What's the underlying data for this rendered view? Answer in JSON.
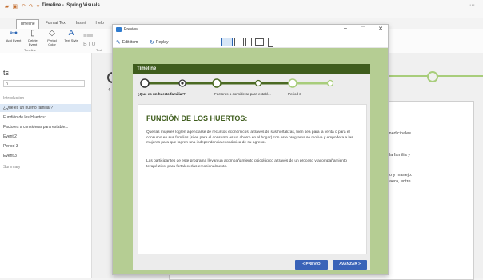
{
  "app": {
    "title": "Timeline - iSpring Visuals",
    "more": "···"
  },
  "ribbon": {
    "tabs": [
      "Timeline",
      "Format Text",
      "Insert",
      "Help"
    ],
    "buttons": {
      "add_event": "Add Event",
      "delete_event": "Delete Event",
      "period_color": "Period Color",
      "text_style": "Text Style"
    },
    "group_timeline": "Timeline",
    "group_text": "Text",
    "format_glyphs": "B  I  U"
  },
  "sidebar": {
    "title": "ts",
    "search_value": "n",
    "items": [
      "Introduction",
      "¿Qué es un huerto familiar?",
      "Fundión de los Huertos:",
      "Factores a considerar para estable...",
      "Event 2",
      "Period 3",
      "Event 3",
      "Summary"
    ],
    "selected_index": 1
  },
  "canvas": {
    "node_label": "4",
    "bg_text": [
      "medicinales.",
      "la familia y",
      "o y manejo.",
      "aera, entre"
    ]
  },
  "preview": {
    "window_title": "Preview",
    "controls": {
      "minimize": "–",
      "maximize": "☐",
      "close": "✕"
    },
    "toolbar": {
      "edit_item": "Edit item",
      "replay": "Replay"
    },
    "slide": {
      "header": "Timeline",
      "timeline_labels": [
        "¿Qué es un huerto familiar?",
        "Factores a considerar para establ...",
        "Period 3"
      ],
      "card_title": "FUNCIÓN DE LOS HUERTOS:",
      "paragraph1": "Que las mujeres logren agenciarse de recursos económicos, a través de sus hortalizas, bien sea para la venta o para el consumo en sus familias (si es para el consumo es un ahorro en el hogar) con este programa se motiva y empodera a las mujeres para que logren una independencia económica de su agresor.",
      "paragraph2": "Las participantes de este programa llevan un acompañamiento psicológico a través de un proceso y acompañamiento terapéutico, para fortalecerlas emocionalmente.",
      "prev_button": "< PREVIO",
      "next_button": "AVANZAR >"
    }
  },
  "colors": {
    "header_green": "#3f5d1d",
    "stage_green": "#b5cd93",
    "line_green": "#a8cd7b",
    "button_blue": "#3a63b8"
  }
}
